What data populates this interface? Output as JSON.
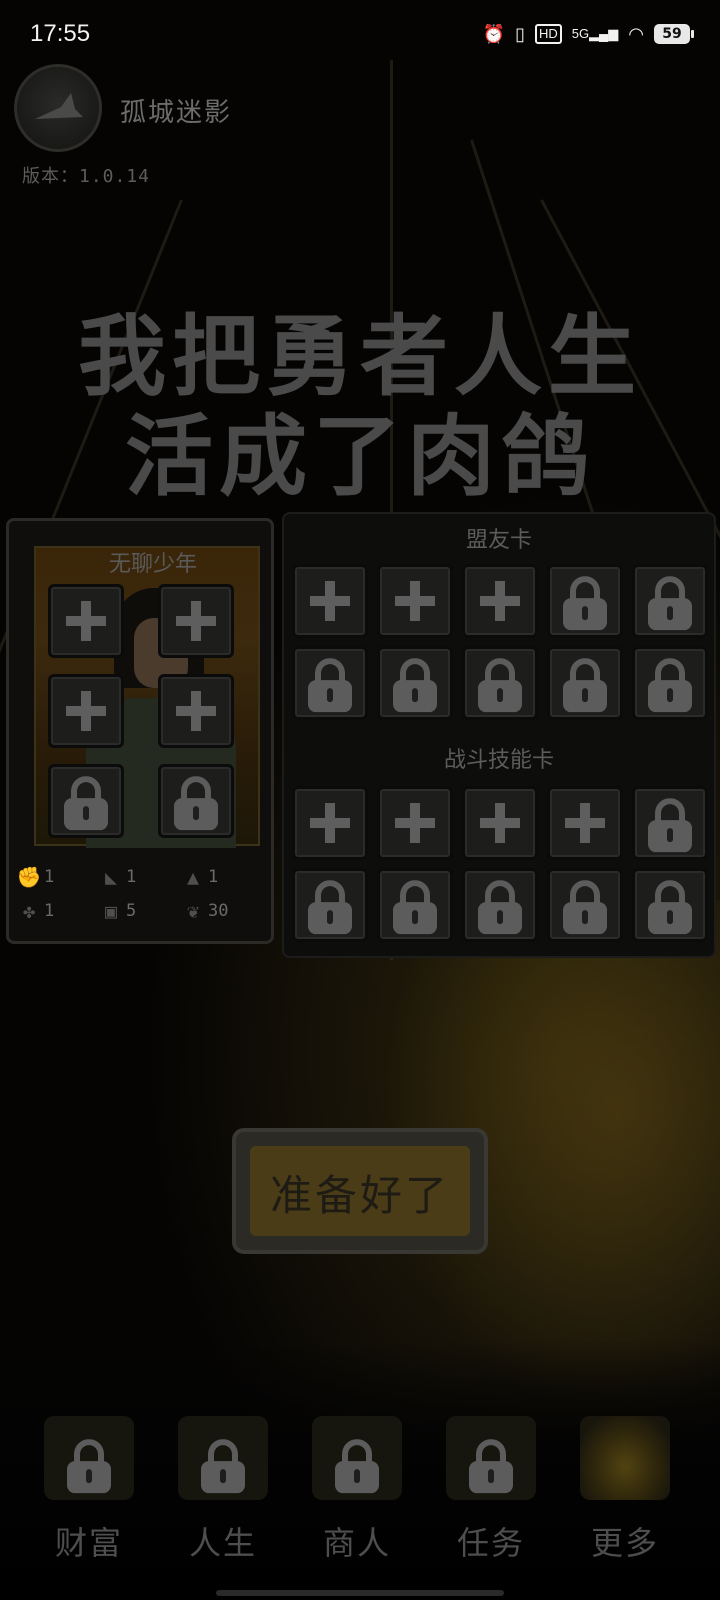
{
  "status_bar": {
    "time": "17:55",
    "icons": [
      "alarm-icon",
      "vibrate-icon",
      "hd-icon",
      "5g-signal-icon",
      "wifi-icon"
    ],
    "network_label": "5G",
    "hd_label": "HD",
    "battery": "59"
  },
  "header": {
    "game_title": "孤城迷影",
    "version": "版本：1.0.14"
  },
  "headline": {
    "line1": "我把勇者人生",
    "line2": "活成了肉鸽"
  },
  "character": {
    "name": "无聊少年",
    "slots": [
      "plus",
      "plus",
      "plus",
      "plus",
      "lock",
      "lock"
    ],
    "stats": [
      {
        "icon": "fist-icon",
        "value": "1"
      },
      {
        "icon": "boot-icon",
        "value": "1"
      },
      {
        "icon": "potion-icon",
        "value": "1"
      },
      {
        "icon": "clover-icon",
        "value": "1"
      },
      {
        "icon": "armor-icon",
        "value": "5"
      },
      {
        "icon": "wings-icon",
        "value": "30"
      }
    ]
  },
  "ally_cards": {
    "title": "盟友卡",
    "slots": [
      "plus",
      "plus",
      "plus",
      "lock",
      "lock",
      "lock",
      "lock",
      "lock",
      "lock",
      "lock"
    ]
  },
  "skill_cards": {
    "title": "战斗技能卡",
    "slots": [
      "plus",
      "plus",
      "plus",
      "plus",
      "lock",
      "lock",
      "lock",
      "lock",
      "lock",
      "lock"
    ]
  },
  "ready_button": {
    "label": "准备好了"
  },
  "bottom_nav": [
    {
      "label": "财富",
      "locked": true
    },
    {
      "label": "人生",
      "locked": true
    },
    {
      "label": "商人",
      "locked": true
    },
    {
      "label": "任务",
      "locked": true
    },
    {
      "label": "更多",
      "locked": false
    }
  ],
  "colors": {
    "background": "#0a0907",
    "dim_text": "#5c5c5c",
    "button_gold": "#4a3c17"
  }
}
